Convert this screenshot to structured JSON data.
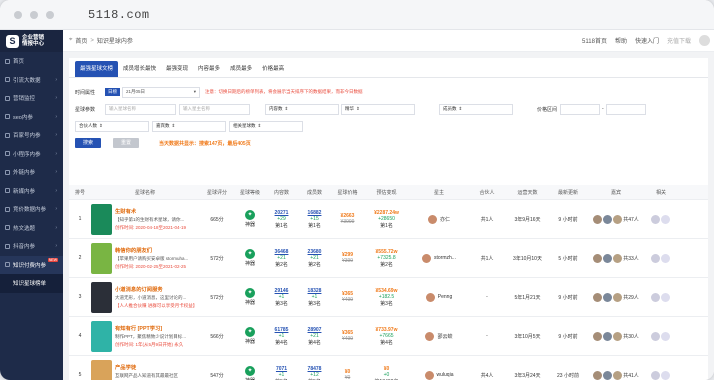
{
  "browser": {
    "url": "5118.com"
  },
  "sidebar": {
    "logo_line1": "企业营销",
    "logo_line2": "情报中心",
    "items": [
      {
        "label": "首页"
      },
      {
        "label": "引流大数据"
      },
      {
        "label": "营销监控"
      },
      {
        "label": "seo内参"
      },
      {
        "label": "百家号内参"
      },
      {
        "label": "小程序内参"
      },
      {
        "label": "外链内参"
      },
      {
        "label": "新媒内参"
      },
      {
        "label": "竞价数据内参"
      },
      {
        "label": "热文选题"
      },
      {
        "label": "抖音内参"
      },
      {
        "label": "知识付费内参",
        "badge": "NEW"
      },
      {
        "label": "知识星球榜单"
      }
    ]
  },
  "topbar": {
    "breadcrumb_home": "首页",
    "breadcrumb_sep": ">",
    "breadcrumb_current": "知识星球内参",
    "links": [
      "5118首页",
      "帮助",
      "快速入门",
      "充值下载"
    ]
  },
  "tabs": [
    "最强星球文榜",
    "成员增长最快",
    "最强变现",
    "内容最多",
    "成员最多",
    "价格最高"
  ],
  "filters": {
    "time_label": "时间属性",
    "period_chip": "日榜",
    "date_value": "21月05日",
    "notice": "注意：切换日期后的榜单列表，将会展示当天排序下的数据结果，而非今日数据",
    "keyword_label": "星球参数",
    "keyword_placeholder1": "输入星球名称",
    "keyword_placeholder2": "输入星主名称",
    "content_label": "内容数",
    "essence_label": "精华",
    "members_label": "成员数",
    "price_label": "价格区间",
    "partner_label": "合伙人数",
    "guests_label": "嘉宾数",
    "related_label": "相关星球数",
    "search_btn": "搜索",
    "reset_btn": "重置",
    "summary": "当天数据共显示：搜索147页，最后405页"
  },
  "table": {
    "headers": [
      "排号",
      "星球名称",
      "星球评分",
      "星球等级",
      "内容数",
      "成员数",
      "星球价格",
      "预估变现",
      "星主",
      "合伙人",
      "运营天数",
      "最新更新",
      "嘉宾",
      "相关"
    ],
    "rows": [
      {
        "rank": "1",
        "name": "生财有术",
        "desc": "【知乎第1的生财有术星球，请你...",
        "date": "创作时间: 2020-04-18至2021-04-19",
        "score": "665分",
        "level": "神器",
        "content": "20271",
        "content_delta": "+29",
        "content_rank": "第1名",
        "members": "16882",
        "members_delta": "+15",
        "members_rank": "第1名",
        "price": "¥2663",
        "price_old": "¥3999",
        "revenue": "¥2287.24w",
        "revenue_delta": "+28650",
        "revenue_rank": "第1名",
        "owner": "亦仁",
        "partner": "共1人",
        "days": "3年9月16天",
        "updated": "9 小时前",
        "guests": "共47人",
        "thumb_color": "#1a8a5a"
      },
      {
        "rank": "2",
        "name": "韩信你的朋友们",
        "desc": "【苹果用户请购买安卓版 stormuha...",
        "date": "创作时间: 2020-02-25至2021-02-25",
        "score": "572分",
        "level": "神器",
        "content": "36468",
        "content_delta": "+21",
        "content_rank": "第2名",
        "members": "23680",
        "members_delta": "+21",
        "members_rank": "第2名",
        "price": "¥299",
        "price_old": "¥399",
        "revenue": "¥555.72w",
        "revenue_delta": "+7325.8",
        "revenue_rank": "第2名",
        "owner": "stormzh...",
        "partner": "共1人",
        "days": "3年10月10天",
        "updated": "5 小时前",
        "guests": "共33人",
        "thumb_color": "#79b543"
      },
      {
        "rank": "3",
        "name": "小道消息的订阅服务",
        "desc": "大道无形，小道消息，这里讨论的...",
        "date": "【人人推合伙赚 进群可以享受月卡权益】",
        "score": "572分",
        "level": "神器",
        "content": "29146",
        "content_delta": "+1",
        "content_rank": "第3名",
        "members": "18328",
        "members_delta": "+1",
        "members_rank": "第3名",
        "price": "¥365",
        "price_old": "¥499",
        "revenue": "¥534.69w",
        "revenue_delta": "+182.5",
        "revenue_rank": "第3名",
        "owner": "Penng",
        "partner": "-",
        "days": "5年1月21天",
        "updated": "9 小时前",
        "guests": "共29人",
        "thumb_color": "#2b2f38"
      },
      {
        "rank": "4",
        "name": "有知有行 [PPT学习]",
        "desc": "制作PPT，聚焦精致少说计划目标...",
        "date": "创作时间: 1年(从5月9日开始) 永久",
        "score": "566分",
        "level": "神器",
        "content": "61785",
        "content_delta": "+1",
        "content_rank": "第4名",
        "members": "28907",
        "members_delta": "+21",
        "members_rank": "第4名",
        "price": "¥365",
        "price_old": "¥499",
        "revenue": "¥733.97w",
        "revenue_delta": "+7665",
        "revenue_rank": "第4名",
        "owner": "邵云蛟",
        "partner": "-",
        "days": "3年10月5天",
        "updated": "9 小时前",
        "guests": "共30人",
        "thumb_color": "#2fb3a7"
      },
      {
        "rank": "5",
        "name": "产品学徒",
        "desc": "互联网产品人知道有其最最社区",
        "date": "创作时间: 免费",
        "score": "547分",
        "level": "神器",
        "content": "7071",
        "content_delta": "+1",
        "content_rank": "第5名",
        "members": "78478",
        "members_delta": "+12",
        "members_rank": "第5名",
        "price": "¥0",
        "price_old": "¥0",
        "revenue": "¥0",
        "revenue_delta": "+0",
        "revenue_rank": "第13498名",
        "owner": "wuluqia",
        "partner": "共4人",
        "days": "3年3月24天",
        "updated": "23 小时前",
        "guests": "共41人",
        "thumb_color": "#d9a35a"
      }
    ]
  },
  "colors": {
    "sidebar_bg": "#1e2b49",
    "accent": "#2552b3",
    "orange": "#f07a1a",
    "green": "#19a05c"
  }
}
